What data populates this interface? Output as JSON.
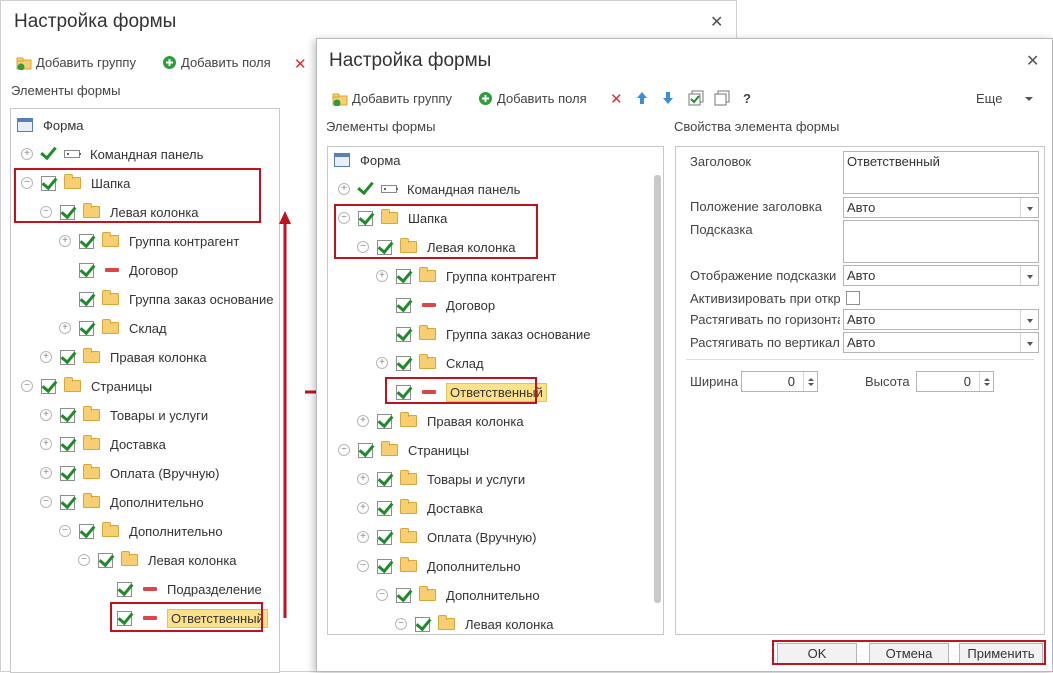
{
  "back_dialog": {
    "title": "Настройка формы",
    "toolbar": {
      "add_group": "Добавить группу",
      "add_fields": "Добавить поля"
    },
    "section_label": "Элементы формы",
    "tree": [
      {
        "label": "Форма"
      },
      {
        "label": "Командная панель"
      },
      {
        "label": "Шапка"
      },
      {
        "label": "Левая колонка"
      },
      {
        "label": "Группа контрагент"
      },
      {
        "label": "Договор"
      },
      {
        "label": "Группа заказ основание"
      },
      {
        "label": "Склад"
      },
      {
        "label": "Правая колонка"
      },
      {
        "label": "Страницы"
      },
      {
        "label": "Товары и услуги"
      },
      {
        "label": "Доставка"
      },
      {
        "label": "Оплата (Вручную)"
      },
      {
        "label": "Дополнительно"
      },
      {
        "label": "Дополнительно"
      },
      {
        "label": "Левая колонка"
      },
      {
        "label": "Подразделение"
      },
      {
        "label": "Ответственный"
      }
    ]
  },
  "front_dialog": {
    "title": "Настройка формы",
    "toolbar": {
      "add_group": "Добавить группу",
      "add_fields": "Добавить поля",
      "help": "?",
      "more": "Еще"
    },
    "section_label": "Элементы формы",
    "tree": [
      {
        "label": "Форма"
      },
      {
        "label": "Командная панель"
      },
      {
        "label": "Шапка"
      },
      {
        "label": "Левая колонка"
      },
      {
        "label": "Группа контрагент"
      },
      {
        "label": "Договор"
      },
      {
        "label": "Группа заказ основание"
      },
      {
        "label": "Склад"
      },
      {
        "label": "Ответственный"
      },
      {
        "label": "Правая колонка"
      },
      {
        "label": "Страницы"
      },
      {
        "label": "Товары и услуги"
      },
      {
        "label": "Доставка"
      },
      {
        "label": "Оплата (Вручную)"
      },
      {
        "label": "Дополнительно"
      },
      {
        "label": "Дополнительно"
      },
      {
        "label": "Левая колонка"
      }
    ],
    "properties": {
      "section_label": "Свойства элемента формы",
      "caption_label": "Заголовок",
      "caption_value": "Ответственный",
      "caption_position_label": "Положение заголовка",
      "caption_position_value": "Авто",
      "tooltip_label": "Подсказка",
      "tooltip_value": "",
      "tooltip_display_label": "Отображение подсказки",
      "tooltip_display_value": "Авто",
      "activate_label": "Активизировать при открытии",
      "stretch_h_label": "Растягивать по горизонтали",
      "stretch_h_value": "Авто",
      "stretch_v_label": "Растягивать по вертикали",
      "stretch_v_value": "Авто",
      "width_label": "Ширина",
      "width_value": "0",
      "height_label": "Высота",
      "height_value": "0"
    },
    "buttons": {
      "ok": "OK",
      "cancel": "Отмена",
      "apply": "Применить"
    }
  },
  "colors": {
    "highlight_border": "#c1121f",
    "check_green": "#1f8b2a",
    "selection_fill": "#fbe28a"
  }
}
